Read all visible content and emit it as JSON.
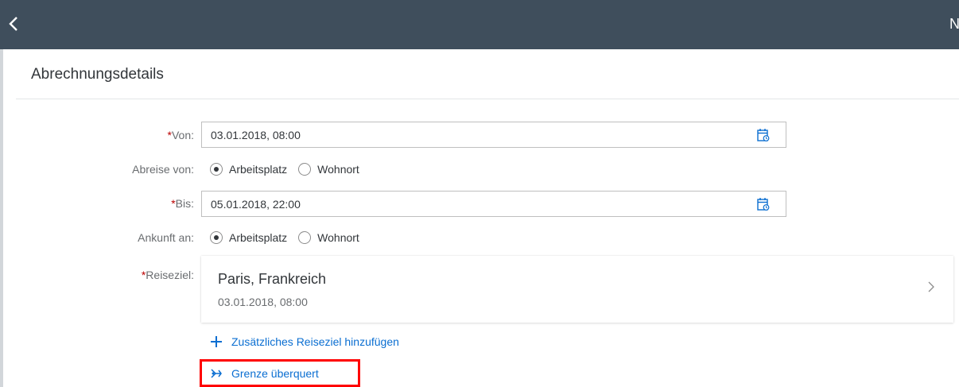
{
  "header": {
    "edge_text": "N"
  },
  "section": {
    "title": "Abrechnungsdetails"
  },
  "fields": {
    "von": {
      "label": "Von:",
      "value": "03.01.2018, 08:00"
    },
    "abreise": {
      "label": "Abreise von:",
      "options": [
        "Arbeitsplatz",
        "Wohnort"
      ],
      "selected": "Arbeitsplatz"
    },
    "bis": {
      "label": "Bis:",
      "value": "05.01.2018, 22:00"
    },
    "ankunft": {
      "label": "Ankunft an:",
      "options": [
        "Arbeitsplatz",
        "Wohnort"
      ],
      "selected": "Arbeitsplatz"
    },
    "reiseziel": {
      "label": "Reiseziel:",
      "destination": "Paris, Frankreich",
      "date": "03.01.2018, 08:00"
    }
  },
  "required_marker": "*",
  "actions": {
    "add_destination": "Zusätzliches Reiseziel hinzufügen",
    "border_crossed": "Grenze überquert"
  },
  "colors": {
    "header_bg": "#3f4e5c",
    "link": "#0a6ed1",
    "required": "#bb0000",
    "highlight": "#ff0000"
  }
}
